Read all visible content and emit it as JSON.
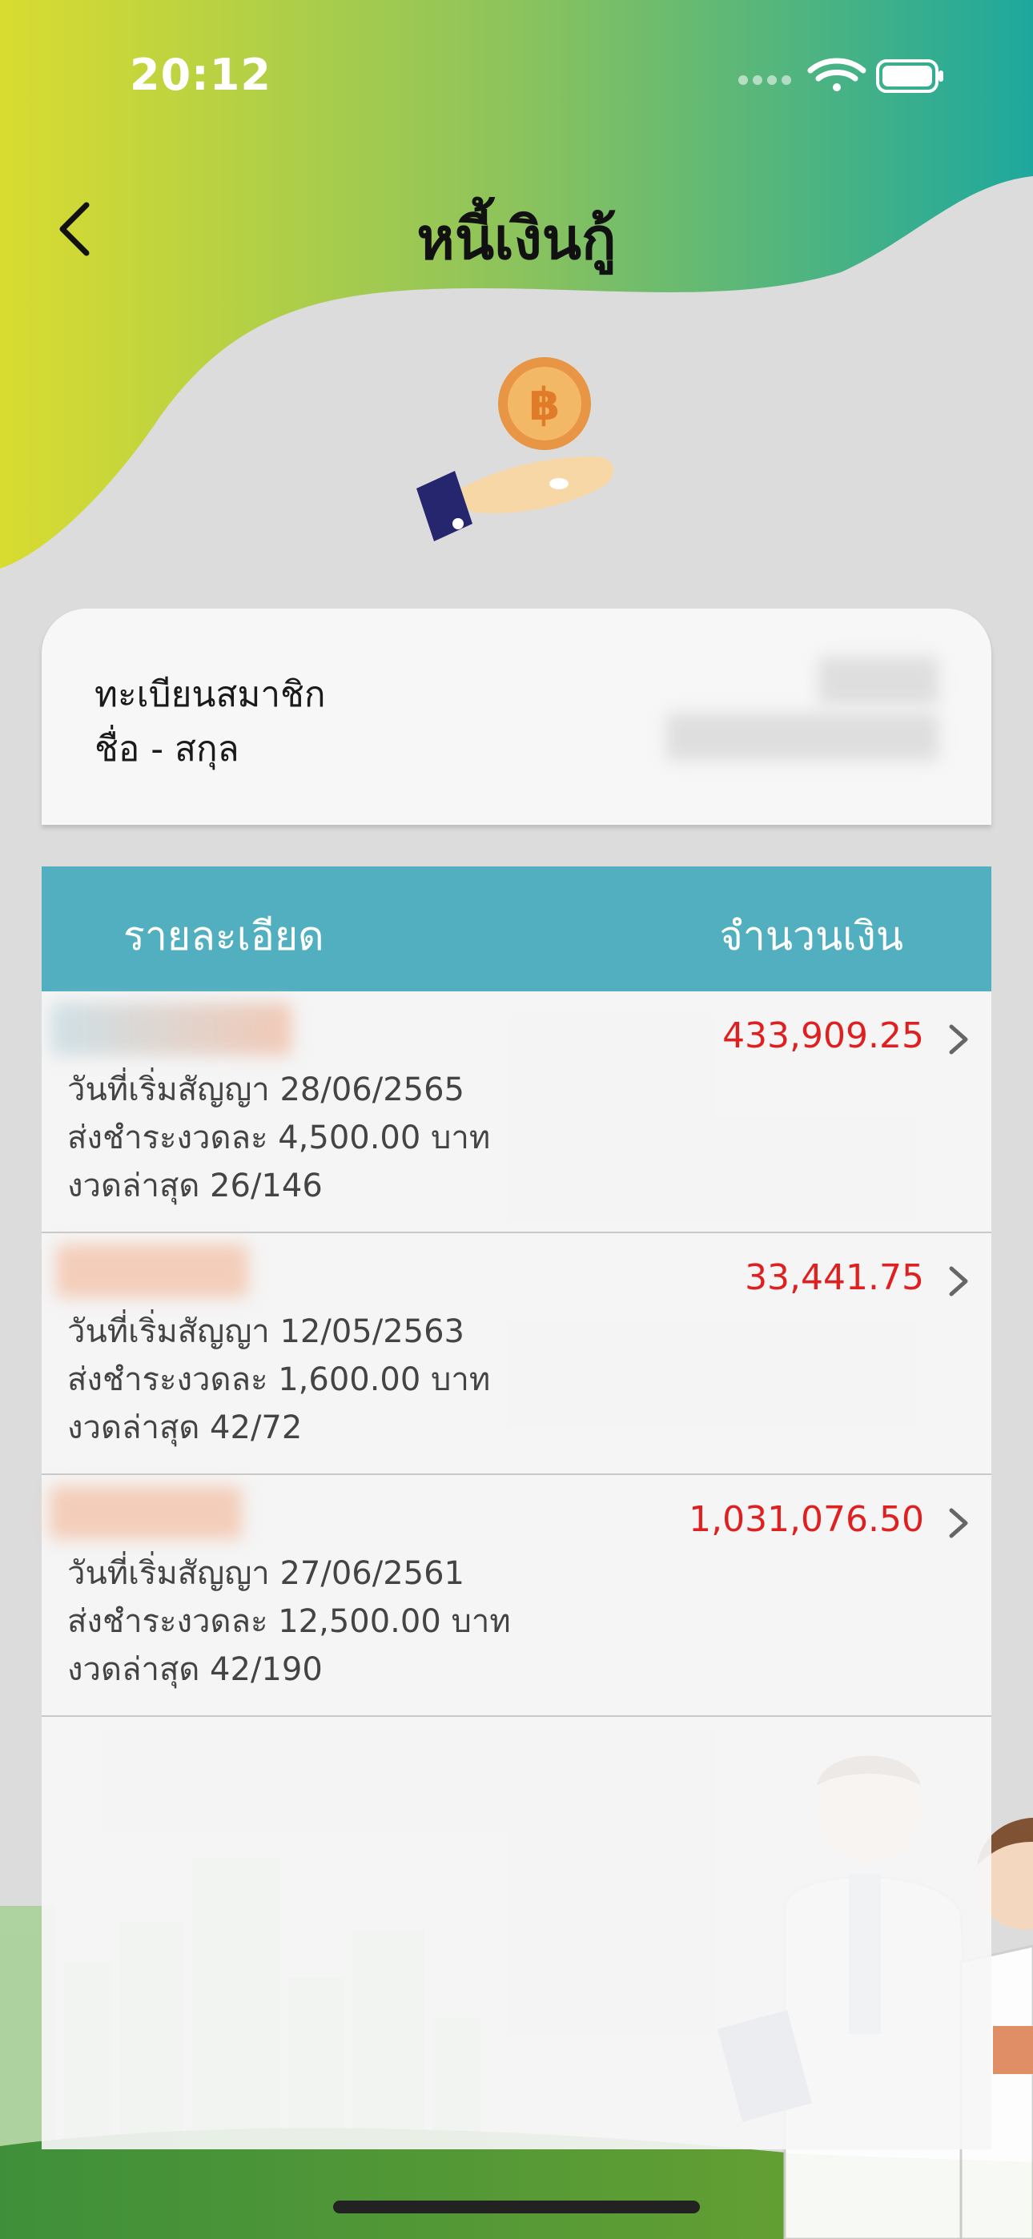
{
  "status_bar": {
    "time": "20:12"
  },
  "header": {
    "title": "หนี้เงินกู้"
  },
  "member": {
    "id_label": "ทะเบียนสมาชิก",
    "name_label": "ชื่อ - สกุล"
  },
  "table": {
    "col_detail": "รายละเอียด",
    "col_amount": "จำนวนเงิน",
    "rows": [
      {
        "start_date": "วันที่เริ่มสัญญา 28/06/2565",
        "installment": "ส่งชำระงวดละ 4,500.00 บาท",
        "latest": "งวดล่าสุด 26/146",
        "amount": "433,909.25"
      },
      {
        "start_date": "วันที่เริ่มสัญญา 12/05/2563",
        "installment": "ส่งชำระงวดละ 1,600.00 บาท",
        "latest": "งวดล่าสุด 42/72",
        "amount": "33,441.75"
      },
      {
        "start_date": "วันที่เริ่มสัญญา 27/06/2561",
        "installment": "ส่งชำระงวดละ 12,500.00 บาท",
        "latest": "งวดล่าสุด 42/190",
        "amount": "1,031,076.50"
      }
    ]
  },
  "colors": {
    "header_gradient_start": "#d7dc32",
    "header_gradient_end": "#1fa79c",
    "table_header": "#51afc0",
    "amount": "#e02020"
  },
  "icons": [
    "back-chevron-icon",
    "wifi-icon",
    "battery-icon",
    "loan-coin-hand-icon",
    "chevron-right-icon"
  ]
}
